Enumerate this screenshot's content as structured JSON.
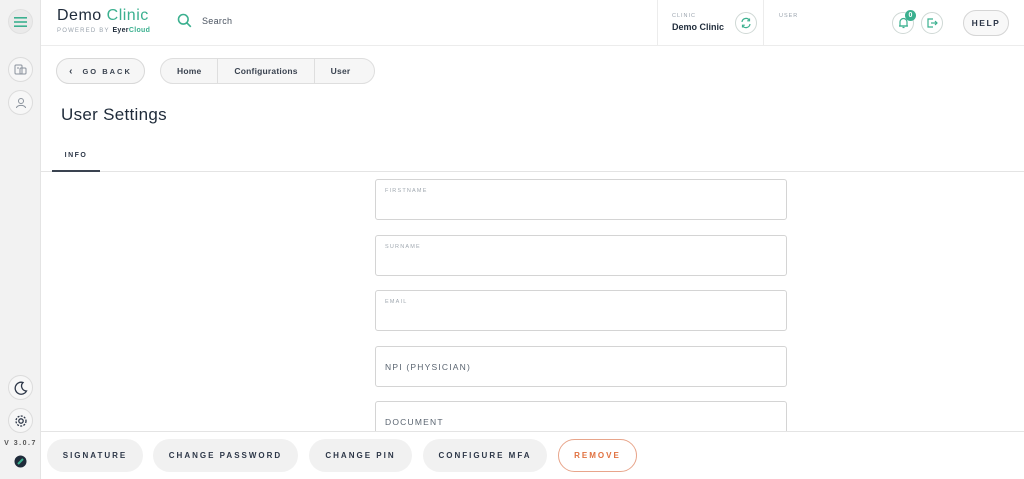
{
  "header": {
    "brand_title_main": "Demo",
    "brand_title_accent": "Clinic",
    "brand_powered": "POWERED BY",
    "brand_product_a": "Eyer",
    "brand_product_b": "Cloud",
    "search_label": "Search",
    "clinic_caption": "CLINIC",
    "clinic_name": "Demo Clinic",
    "user_caption": "USER",
    "notification_count": "0",
    "help_label": "HELP"
  },
  "sidebar": {
    "version": "V 3.0.7"
  },
  "nav": {
    "go_back_label": "GO BACK",
    "breadcrumb": [
      "Home",
      "Configurations",
      "User"
    ]
  },
  "page": {
    "title": "User Settings",
    "tabs": [
      {
        "label": "INFO",
        "active": true
      }
    ]
  },
  "form": {
    "fields": [
      {
        "label": "FIRSTNAME",
        "value": ""
      },
      {
        "label": "SURNAME",
        "value": ""
      },
      {
        "label": "EMAIL",
        "value": ""
      },
      {
        "label": "NPI (PHYSICIAN)",
        "value": ""
      },
      {
        "label": "DOCUMENT",
        "value": ""
      }
    ]
  },
  "footer": {
    "buttons": [
      "SIGNATURE",
      "CHANGE PASSWORD",
      "CHANGE PIN",
      "CONFIGURE MFA",
      "REMOVE"
    ]
  },
  "colors": {
    "accent": "#3bb08f",
    "danger": "#e0703f",
    "text_dark": "#1f2b3a"
  },
  "icons": [
    "menu-icon",
    "search-icon",
    "refresh-icon",
    "bell-icon",
    "logout-icon",
    "chevron-left-icon",
    "clinic-icon",
    "user-icon",
    "moon-icon",
    "gear-icon",
    "logo-icon"
  ]
}
